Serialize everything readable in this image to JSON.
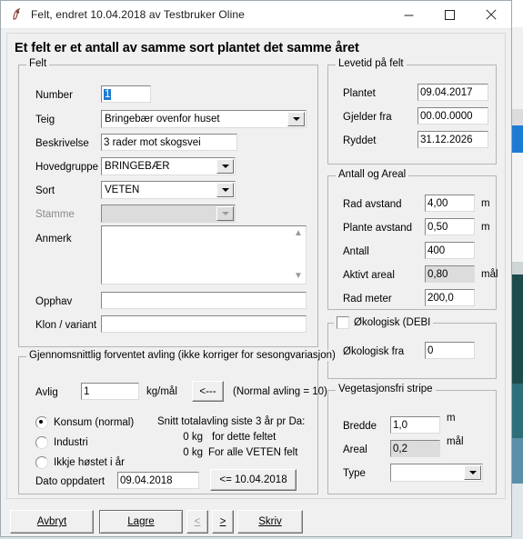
{
  "window": {
    "title": "Felt, endret 10.04.2018 av Testbruker Oline",
    "icon": "app-icon",
    "minimize": "minimize-icon",
    "maximize": "maximize-icon",
    "close": "close-icon"
  },
  "headline": "Et felt er et antall av samme sort plantet det samme året",
  "felt": {
    "legend": "Felt",
    "number_label": "Number",
    "number_value": "1",
    "teig_label": "Teig",
    "teig_value": "Bringebær ovenfor huset",
    "beskrivelse_label": "Beskrivelse",
    "beskrivelse_value": "3 rader mot skogsvei",
    "hovedgruppe_label": "Hovedgruppe",
    "hovedgruppe_value": "BRINGEBÆR",
    "sort_label": "Sort",
    "sort_value": "VETEN",
    "stamme_label": "Stamme",
    "stamme_value": "",
    "anmerk_label": "Anmerk",
    "anmerk_value": "",
    "opphav_label": "Opphav",
    "opphav_value": "",
    "klon_label": "Klon / variant",
    "klon_value": ""
  },
  "levetid": {
    "legend": "Levetid på felt",
    "plantet_label": "Plantet",
    "plantet_value": "09.04.2017",
    "gjelder_fra_label": "Gjelder fra",
    "gjelder_fra_value": "00.00.0000",
    "ryddet_label": "Ryddet",
    "ryddet_value": "31.12.2026"
  },
  "antall_areal": {
    "legend": "Antall og Areal",
    "rad_avstand_label": "Rad avstand",
    "rad_avstand_value": "4,00",
    "rad_avstand_unit": "m",
    "plante_avstand_label": "Plante avstand",
    "plante_avstand_value": "0,50",
    "plante_avstand_unit": "m",
    "antall_label": "Antall",
    "antall_value": "400",
    "aktivt_areal_label": "Aktivt areal",
    "aktivt_areal_value": "0,80",
    "aktivt_areal_unit": "mål",
    "rad_meter_label": "Rad meter",
    "rad_meter_value": "200,0"
  },
  "okologisk": {
    "legend": "Økologisk (DEBI",
    "checked": false,
    "fra_label": "Økologisk fra",
    "fra_value": "0"
  },
  "vegetasjon": {
    "legend": "Vegetasjonsfri stripe",
    "bredde_label": "Bredde",
    "bredde_value": "1,0",
    "bredde_unit": "m",
    "areal_label": "Areal",
    "areal_value": "0,2",
    "areal_unit": "mål",
    "type_label": "Type",
    "type_value": ""
  },
  "avling": {
    "legend": "Gjennomsnittlig forventet avling (ikke korriger for sesongvariasjon)",
    "avlig_label": "Avlig",
    "avlig_value": "1",
    "avlig_unit": "kg/mål",
    "copy_button": "<---",
    "normal_note": "(Normal avling = 10)",
    "radios": [
      {
        "label": "Konsum (normal)",
        "selected": true
      },
      {
        "label": "Industri",
        "selected": false
      },
      {
        "label": "Ikkje høstet i år",
        "selected": false
      }
    ],
    "snitt_header": "Snitt totalavling siste 3 år pr Da:",
    "snitt_rows": [
      {
        "value": "0 kg",
        "text": "for dette feltet"
      },
      {
        "value": "0 kg",
        "text": "For alle VETEN felt"
      }
    ],
    "dato_label": "Dato oppdatert",
    "dato_value": "09.04.2018",
    "dato_button": "<= 10.04.2018"
  },
  "bottom_bar": {
    "avbryt": "Avbryt",
    "lagre": "Lagre",
    "prev": "<",
    "next": ">",
    "skriv": "Skriv"
  }
}
